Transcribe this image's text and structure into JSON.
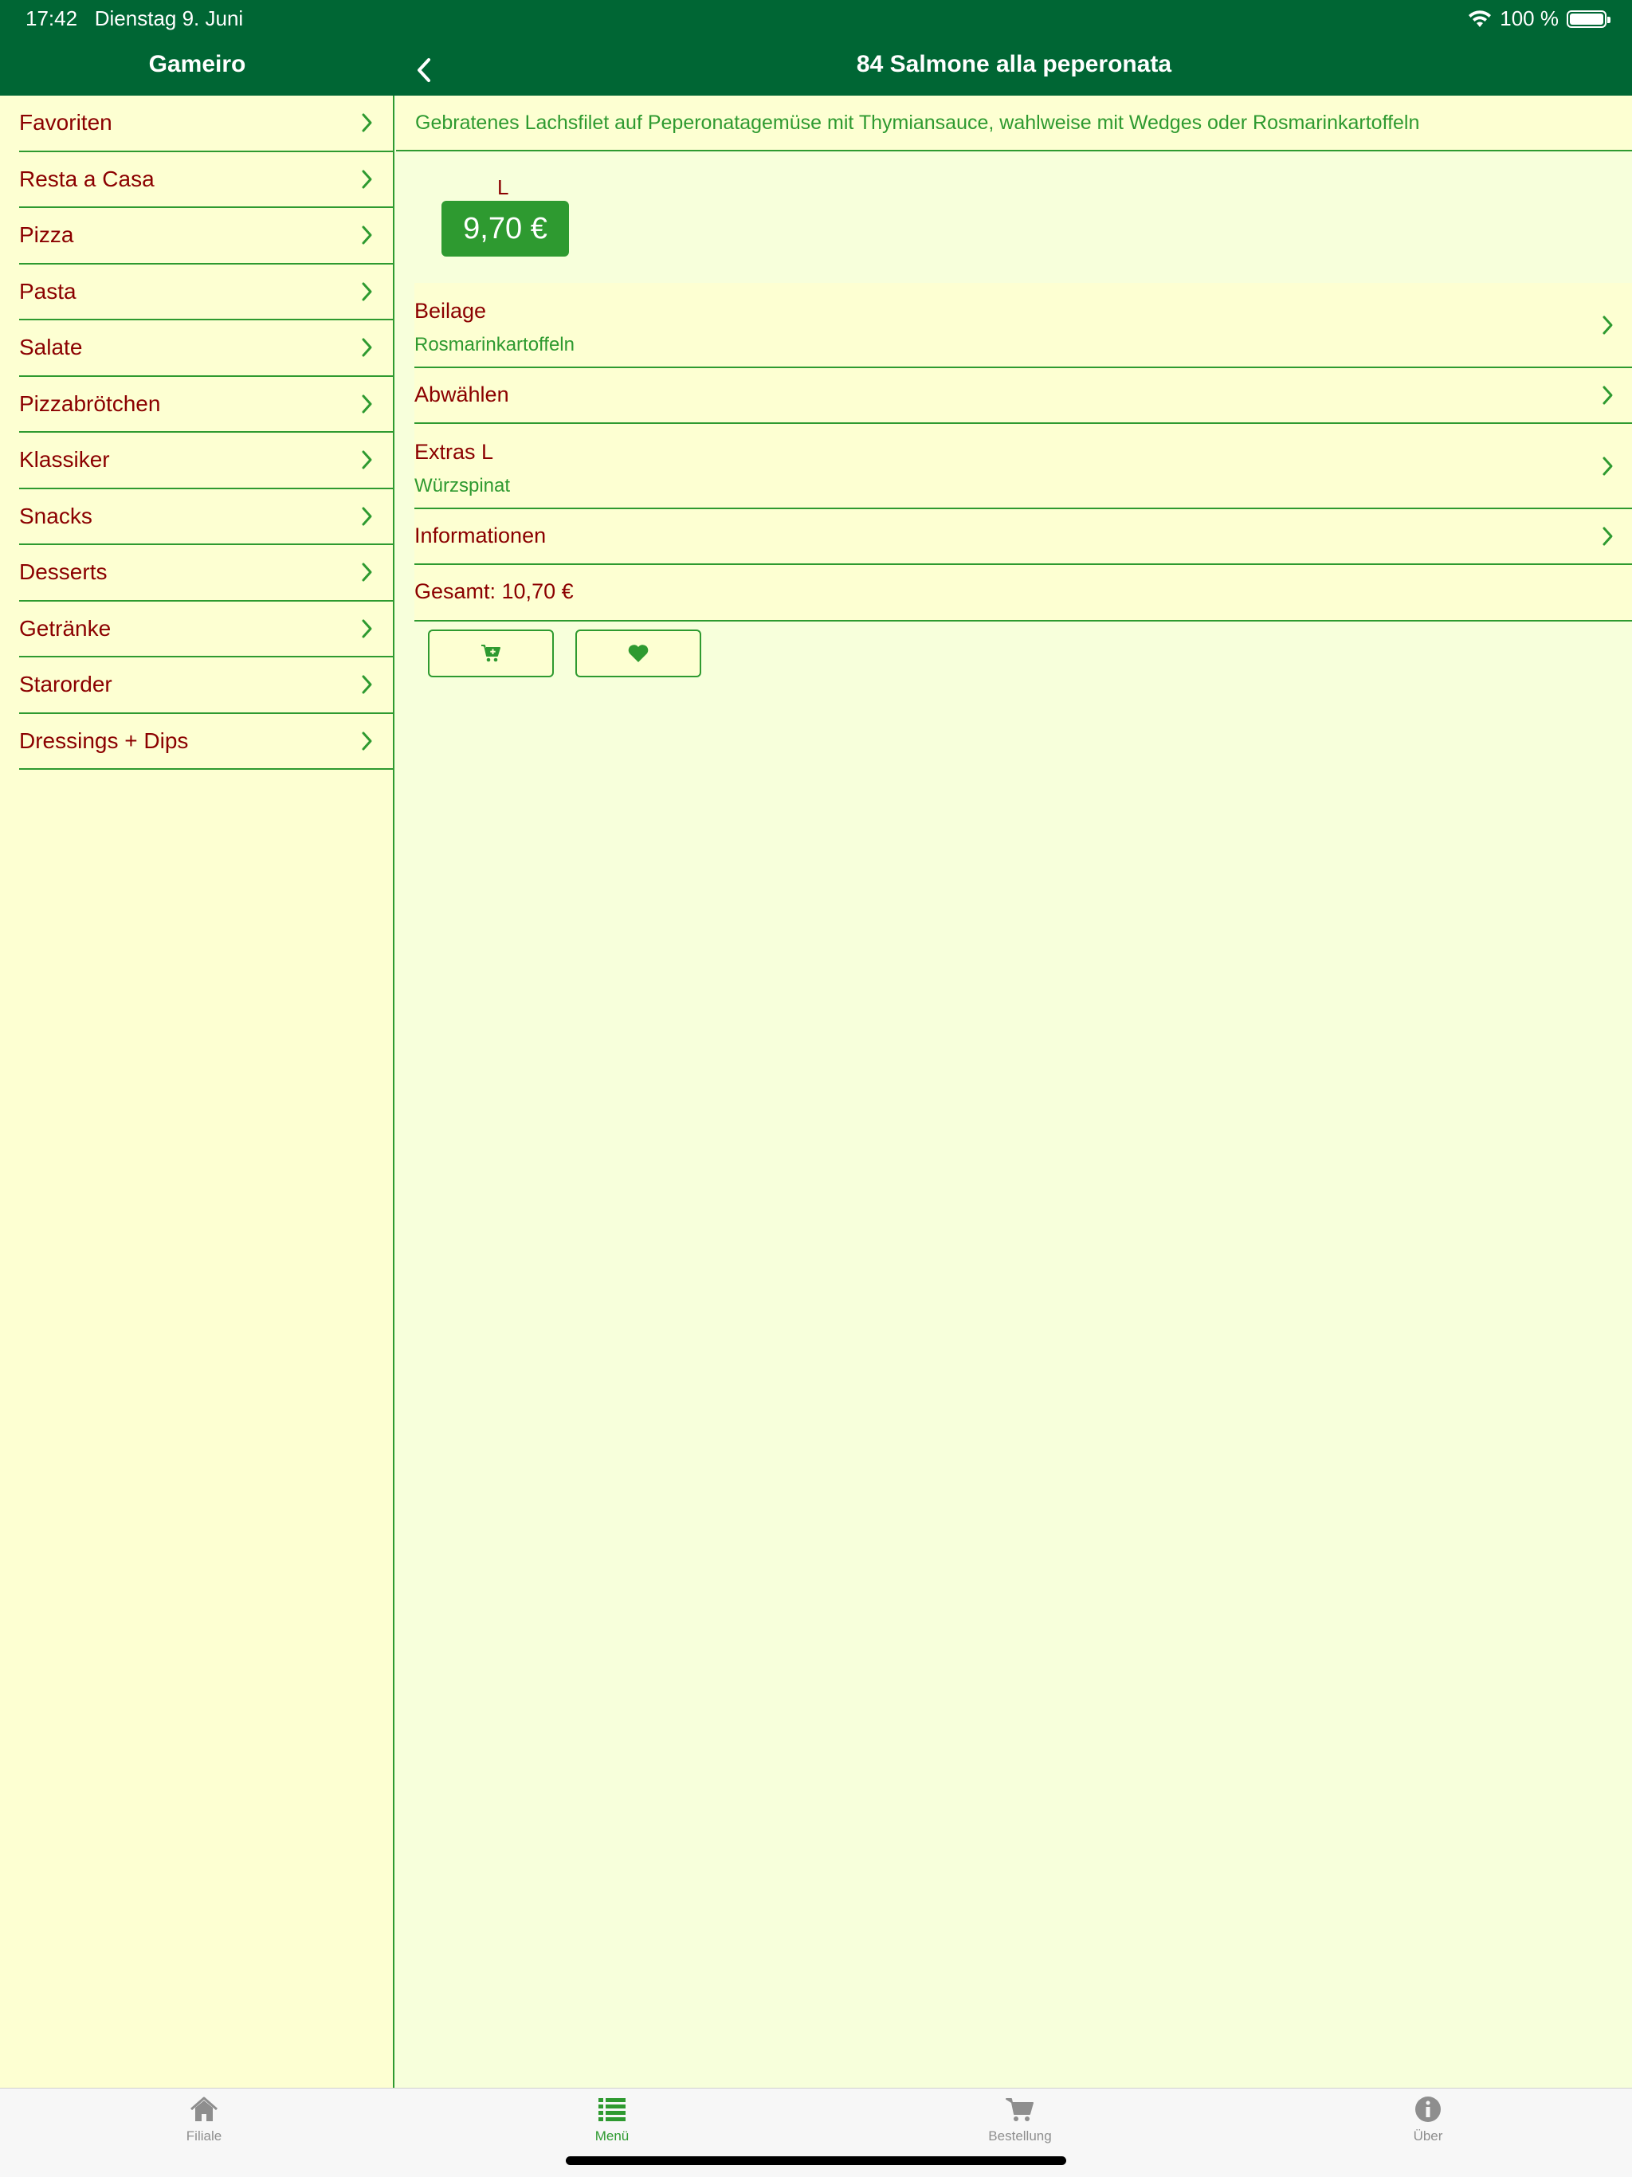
{
  "status_bar": {
    "time": "17:42",
    "date": "Dienstag 9. Juni",
    "battery": "100 %"
  },
  "sidebar": {
    "title": "Gameiro",
    "items": [
      {
        "label": "Favoriten"
      },
      {
        "label": "Resta a Casa"
      },
      {
        "label": "Pizza"
      },
      {
        "label": "Pasta"
      },
      {
        "label": "Salate"
      },
      {
        "label": "Pizzabrötchen"
      },
      {
        "label": "Klassiker"
      },
      {
        "label": "Snacks"
      },
      {
        "label": "Desserts"
      },
      {
        "label": "Getränke"
      },
      {
        "label": "Starorder"
      },
      {
        "label": "Dressings + Dips"
      }
    ]
  },
  "detail": {
    "title": "84 Salmone alla peperonata",
    "description": "Gebratenes Lachsfilet auf Peperonatagemüse mit Thymiansauce, wahlweise mit Wedges oder Rosmarinkartoffeln",
    "size_label": "L",
    "price": "9,70 €",
    "options": [
      {
        "label": "Beilage",
        "value": "Rosmarinkartoffeln"
      },
      {
        "label": "Abwählen",
        "value": ""
      },
      {
        "label": "Extras L",
        "value": "Würzspinat"
      },
      {
        "label": "Informationen",
        "value": ""
      }
    ],
    "total": "Gesamt: 10,70 €"
  },
  "tabbar": {
    "tabs": [
      {
        "label": "Filiale",
        "icon": "home-icon"
      },
      {
        "label": "Menü",
        "icon": "list-icon"
      },
      {
        "label": "Bestellung",
        "icon": "cart-icon"
      },
      {
        "label": "Über",
        "icon": "info-icon"
      }
    ],
    "active": "Menü"
  },
  "colors": {
    "header": "#006634",
    "accent": "#2e9a30",
    "text_dark_red": "#8b0000",
    "background": "#fdffd2"
  }
}
